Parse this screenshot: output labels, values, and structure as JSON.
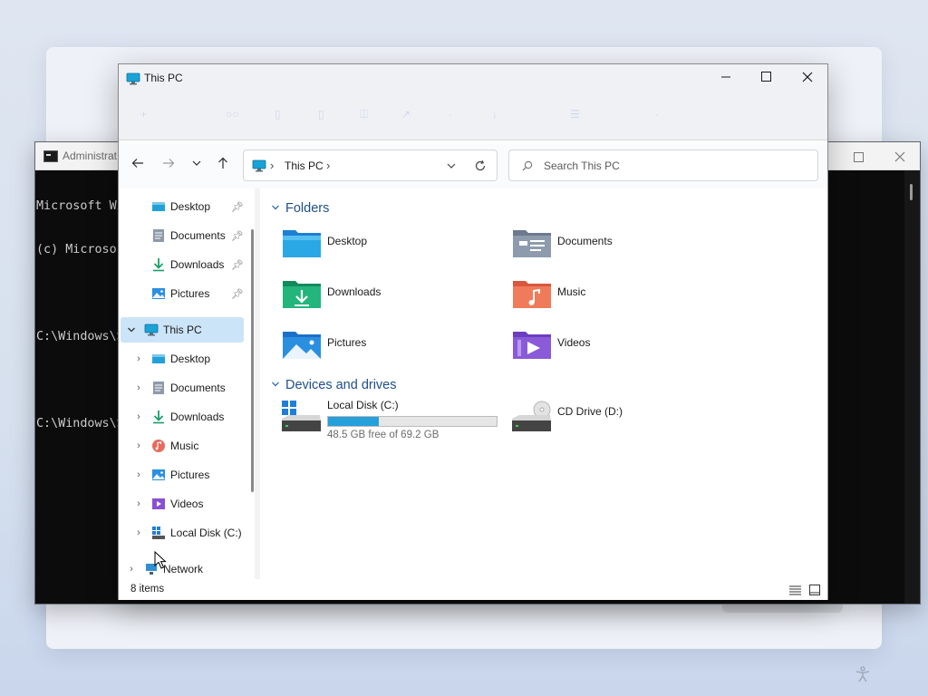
{
  "terminal": {
    "title": "Administrat",
    "lines": [
      "Microsoft Wi",
      "(c) Microso",
      "",
      "C:\\Windows\\S",
      "",
      "C:\\Windows\\S"
    ]
  },
  "window": {
    "title": "This PC",
    "controls": {
      "minimize": "minimize-icon",
      "maximize": "maximize-icon",
      "close": "close-icon"
    }
  },
  "navbar": {
    "address_crumb": "This PC",
    "search_placeholder": "Search This PC"
  },
  "sidebar": {
    "quick_access": [
      {
        "label": "Desktop",
        "icon": "desktop-icon",
        "pinned": true
      },
      {
        "label": "Documents",
        "icon": "documents-icon",
        "pinned": true
      },
      {
        "label": "Downloads",
        "icon": "downloads-icon",
        "pinned": true
      },
      {
        "label": "Pictures",
        "icon": "pictures-icon",
        "pinned": true
      }
    ],
    "this_pc": {
      "label": "This PC",
      "expanded": true,
      "selected": true
    },
    "this_pc_children": [
      {
        "label": "Desktop",
        "icon": "desktop-icon"
      },
      {
        "label": "Documents",
        "icon": "documents-icon"
      },
      {
        "label": "Downloads",
        "icon": "downloads-icon"
      },
      {
        "label": "Music",
        "icon": "music-icon"
      },
      {
        "label": "Pictures",
        "icon": "pictures-icon"
      },
      {
        "label": "Videos",
        "icon": "videos-icon"
      },
      {
        "label": "Local Disk (C:)",
        "icon": "local-disk-icon"
      }
    ],
    "network": {
      "label": "Network",
      "icon": "network-icon"
    }
  },
  "content": {
    "folders_header": "Folders",
    "folders": [
      {
        "label": "Desktop",
        "icon": "desktop-folder-icon"
      },
      {
        "label": "Documents",
        "icon": "documents-folder-icon"
      },
      {
        "label": "Downloads",
        "icon": "downloads-folder-icon"
      },
      {
        "label": "Music",
        "icon": "music-folder-icon"
      },
      {
        "label": "Pictures",
        "icon": "pictures-folder-icon"
      },
      {
        "label": "Videos",
        "icon": "videos-folder-icon"
      }
    ],
    "drives_header": "Devices and drives",
    "drives": [
      {
        "label": "Local Disk (C:)",
        "free_text": "48.5 GB free of 69.2 GB",
        "used_fraction": 0.3
      },
      {
        "label": "CD Drive (D:)"
      }
    ]
  },
  "status": {
    "items_text": "8 items"
  },
  "colors": {
    "accent": "#26a0da",
    "selection": "#cce4f7",
    "group_header": "#1f4e8a"
  }
}
